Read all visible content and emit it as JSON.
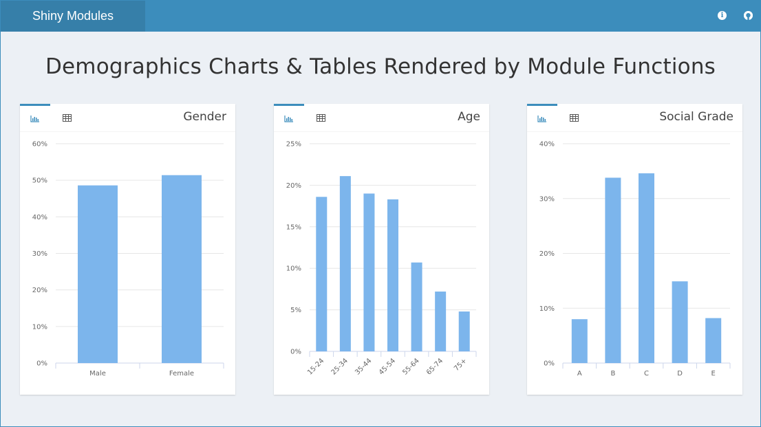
{
  "navbar": {
    "brand": "Shiny Modules",
    "icons": [
      "info-icon",
      "github-icon"
    ],
    "color": "#3c8dbc",
    "brand_color": "#367fa9"
  },
  "page_title": "Demographics Charts & Tables Rendered by Module Functions",
  "bar_color": "#7cb5ec",
  "boxes": [
    {
      "title": "Gender",
      "tabs": [
        "bar-chart-icon",
        "table-icon"
      ],
      "active_tab": "bar-chart-icon",
      "y_ticks": [
        "0%",
        "10%",
        "20%",
        "30%",
        "40%",
        "50%",
        "60%"
      ]
    },
    {
      "title": "Age",
      "tabs": [
        "bar-chart-icon",
        "table-icon"
      ],
      "active_tab": "bar-chart-icon",
      "y_ticks": [
        "0%",
        "5%",
        "10%",
        "15%",
        "20%",
        "25%"
      ]
    },
    {
      "title": "Social Grade",
      "tabs": [
        "bar-chart-icon",
        "table-icon"
      ],
      "active_tab": "bar-chart-icon",
      "y_ticks": [
        "0%",
        "10%",
        "20%",
        "30%",
        "40%"
      ]
    }
  ],
  "chart_data": [
    {
      "type": "bar",
      "categories": [
        "Male",
        "Female"
      ],
      "values": [
        48.6,
        51.4
      ],
      "ylim": [
        0,
        60
      ],
      "y_unit": "%",
      "grid": true
    },
    {
      "type": "bar",
      "categories": [
        "15-24",
        "25-34",
        "35-44",
        "45-54",
        "55-64",
        "65-74",
        "75+"
      ],
      "values": [
        18.6,
        21.1,
        19.0,
        18.3,
        10.7,
        7.2,
        4.8
      ],
      "ylim": [
        0,
        25
      ],
      "y_unit": "%",
      "grid": true
    },
    {
      "type": "bar",
      "categories": [
        "A",
        "B",
        "C",
        "D",
        "E"
      ],
      "values": [
        8.0,
        33.8,
        34.6,
        14.9,
        8.2
      ],
      "ylim": [
        0,
        40
      ],
      "y_unit": "%",
      "grid": true
    }
  ]
}
